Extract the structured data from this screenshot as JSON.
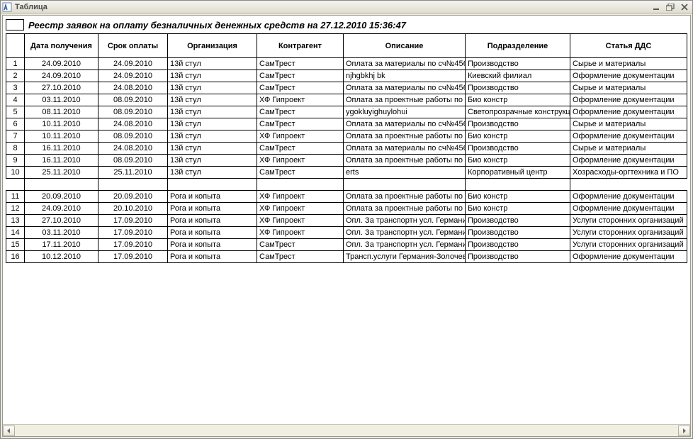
{
  "window": {
    "title": "Таблица"
  },
  "report": {
    "title": "Реестр заявок на оплату безналичных денежных средств на 27.12.2010 15:36:47"
  },
  "columns": {
    "num": "",
    "date_received": "Дата получения",
    "due_date": "Срок оплаты",
    "organization": "Организация",
    "counterparty": "Контрагент",
    "description": "Описание",
    "department": "Подразделение",
    "dds": "Статья ДДС"
  },
  "rows_group1": [
    {
      "n": "1",
      "d1": "24.09.2010",
      "d2": "24.09.2010",
      "org": "13й стул",
      "cp": "СамТрест",
      "desc": "Оплата за материалы по сч№456",
      "dept": "Производство",
      "dds": "Сырье и материалы"
    },
    {
      "n": "2",
      "d1": "24.09.2010",
      "d2": "24.09.2010",
      "org": "13й стул",
      "cp": "СамТрест",
      "desc": "njhgbkhj bk",
      "dept": "Киевский филиал",
      "dds": "Оформление документации"
    },
    {
      "n": "3",
      "d1": "27.10.2010",
      "d2": "24.08.2010",
      "org": "13й стул",
      "cp": "СамТрест",
      "desc": "Оплата за материалы по сч№456",
      "dept": "Производство",
      "dds": "Сырье и материалы"
    },
    {
      "n": "4",
      "d1": "03.11.2010",
      "d2": "08.09.2010",
      "org": "13й стул",
      "cp": "ХФ Гипроект",
      "desc": "Оплата за проектные работы по д",
      "dept": "Био констр",
      "dds": "Оформление документации"
    },
    {
      "n": "5",
      "d1": "08.11.2010",
      "d2": "08.09.2010",
      "org": "13й стул",
      "cp": "СамТрест",
      "desc": "ygokluyighuylohui",
      "dept": "Светопрозрачные конструкц",
      "dds": "Оформление документации"
    },
    {
      "n": "6",
      "d1": "10.11.2010",
      "d2": "24.08.2010",
      "org": "13й стул",
      "cp": "СамТрест",
      "desc": "Оплата за материалы по сч№456",
      "dept": "Производство",
      "dds": "Сырье и материалы"
    },
    {
      "n": "7",
      "d1": "10.11.2010",
      "d2": "08.09.2010",
      "org": "13й стул",
      "cp": "ХФ Гипроект",
      "desc": "Оплата за проектные работы по д",
      "dept": "Био констр",
      "dds": "Оформление документации"
    },
    {
      "n": "8",
      "d1": "16.11.2010",
      "d2": "24.08.2010",
      "org": "13й стул",
      "cp": "СамТрест",
      "desc": "Оплата за материалы по сч№456",
      "dept": "Производство",
      "dds": "Сырье и материалы"
    },
    {
      "n": "9",
      "d1": "16.11.2010",
      "d2": "08.09.2010",
      "org": "13й стул",
      "cp": "ХФ Гипроект",
      "desc": "Оплата за проектные работы по д",
      "dept": "Био констр",
      "dds": "Оформление документации"
    },
    {
      "n": "10",
      "d1": "25.11.2010",
      "d2": "25.11.2010",
      "org": "13й стул",
      "cp": "СамТрест",
      "desc": "erts",
      "dept": "Корпоративный центр",
      "dds": "Хозрасходы-оргтехника и ПО"
    }
  ],
  "rows_group2": [
    {
      "n": "11",
      "d1": "20.09.2010",
      "d2": "20.09.2010",
      "org": "Рога и копыта",
      "cp": "ХФ Гипроект",
      "desc": "Оплата за проектные работы по д",
      "dept": "Био констр",
      "dds": "Оформление документации"
    },
    {
      "n": "12",
      "d1": "24.09.2010",
      "d2": "20.10.2010",
      "org": "Рога и копыта",
      "cp": "ХФ Гипроект",
      "desc": "Оплата за проектные работы по д",
      "dept": "Био констр",
      "dds": "Оформление документации"
    },
    {
      "n": "13",
      "d1": "27.10.2010",
      "d2": "17.09.2010",
      "org": "Рога и копыта",
      "cp": "ХФ Гипроект",
      "desc": "Опл. За транспортн усл. Германи",
      "dept": "Производство",
      "dds": "Услуги сторонних организаций"
    },
    {
      "n": "14",
      "d1": "03.11.2010",
      "d2": "17.09.2010",
      "org": "Рога и копыта",
      "cp": "ХФ Гипроект",
      "desc": "Опл. За транспортн усл. Германи",
      "dept": "Производство",
      "dds": "Услуги сторонних организаций"
    },
    {
      "n": "15",
      "d1": "17.11.2010",
      "d2": "17.09.2010",
      "org": "Рога и копыта",
      "cp": "СамТрест",
      "desc": "Опл. За транспортн усл. Германи",
      "dept": "Производство",
      "dds": "Услуги сторонних организаций"
    },
    {
      "n": "16",
      "d1": "10.12.2010",
      "d2": "17.09.2010",
      "org": "Рога и копыта",
      "cp": "СамТрест",
      "desc": "Трансп.услуги Германия-Золочев",
      "dept": "Производство",
      "dds": "Оформление документации"
    }
  ]
}
